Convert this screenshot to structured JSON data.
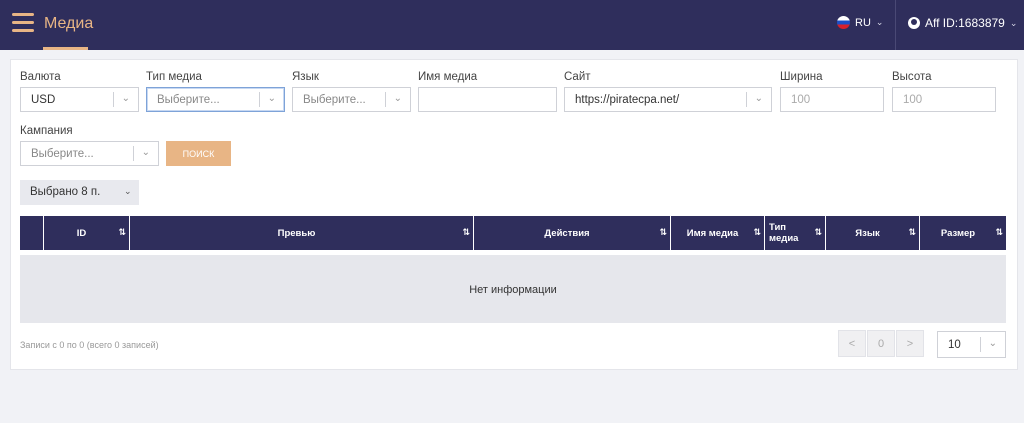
{
  "header": {
    "title": "Медиа",
    "language": "RU",
    "user_label": "Aff ID:1683879"
  },
  "filters": {
    "currency": {
      "label": "Валюта",
      "value": "USD"
    },
    "media_type": {
      "label": "Тип медиа",
      "placeholder": "Выберите..."
    },
    "language": {
      "label": "Язык",
      "placeholder": "Выберите..."
    },
    "media_name": {
      "label": "Имя медиа",
      "value": ""
    },
    "site": {
      "label": "Сайт",
      "value": "https://piratecpa.net/"
    },
    "width": {
      "label": "Ширина",
      "placeholder": "100"
    },
    "height": {
      "label": "Высота",
      "placeholder": "100"
    },
    "campaign": {
      "label": "Кампания",
      "placeholder": "Выберите..."
    },
    "search_button": "ПОИСК"
  },
  "selected_columns": "Выбрано 8 п.",
  "table": {
    "columns": [
      {
        "label": "",
        "sortable": false
      },
      {
        "label": "ID",
        "sortable": true
      },
      {
        "label": "Превью",
        "sortable": true
      },
      {
        "label": "Действия",
        "sortable": true
      },
      {
        "label": "Имя медиа",
        "sortable": true
      },
      {
        "label": "Тип медиа",
        "sortable": true
      },
      {
        "label": "Язык",
        "sortable": true
      },
      {
        "label": "Размер",
        "sortable": true
      }
    ],
    "empty_text": "Нет информации"
  },
  "footer": {
    "records_text": "Записи с 0 по 0 (всего 0 записей)",
    "prev": "<",
    "current_page": "0",
    "next": ">",
    "page_size": "10"
  },
  "colors": {
    "header_bg": "#2f2e5c",
    "accent": "#e8b585"
  }
}
